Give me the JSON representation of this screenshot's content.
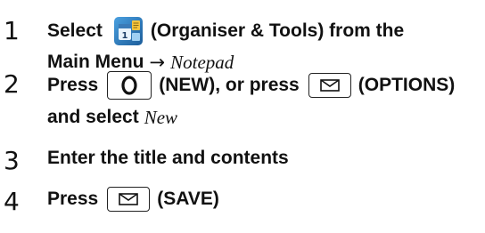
{
  "steps": [
    {
      "number": "1",
      "line1": {
        "pre": "Select",
        "post": "(Organiser & Tools) from the"
      },
      "line2": {
        "text": "Main Menu",
        "arrow": "→",
        "italic": "Notepad"
      }
    },
    {
      "number": "2",
      "line1": {
        "pre": "Press",
        "mid": "(NEW), or press",
        "post": "(OPTIONS)"
      },
      "line2": {
        "text": "and select",
        "italic": "New"
      }
    },
    {
      "number": "3",
      "line1": {
        "text": "Enter the title and contents"
      }
    },
    {
      "number": "4",
      "line1": {
        "pre": "Press",
        "post": "(SAVE)"
      }
    }
  ],
  "icons": {
    "app": "organiser-tools-icon",
    "center_key": "center-key-icon",
    "mail_key": "mail-key-icon"
  }
}
